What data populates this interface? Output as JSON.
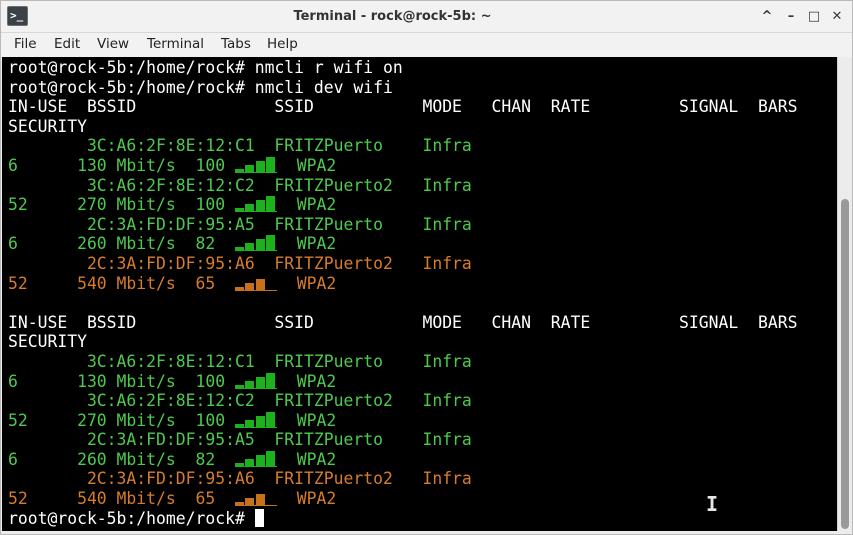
{
  "window": {
    "title": "Terminal - rock@rock-5b: ~",
    "icon": "terminal-app-icon",
    "icon_glyph": ">_",
    "controls": {
      "chevron": "^",
      "minimize": "–",
      "maximize": "□",
      "close": "✕"
    }
  },
  "menubar": [
    "File",
    "Edit",
    "View",
    "Terminal",
    "Tabs",
    "Help"
  ],
  "colors": {
    "background": "#000000",
    "text": "#ffffff",
    "green": "#4ec94e",
    "orange": "#d87c2c",
    "bar_green": "#1db11d",
    "bar_orange": "#c8711c"
  },
  "terminal": {
    "prompt": "root@rock-5b:/home/rock#",
    "commands": [
      "nmcli r wifi on",
      "nmcli dev wifi"
    ],
    "header_line1": "IN-USE  BSSID              SSID           MODE   CHAN  RATE         SIGNAL  BARS",
    "header_line2": "SECURITY",
    "networks": [
      {
        "bssid_line": "        3C:A6:2F:8E:12:C1  FRITZPuerto    Infra",
        "detail_line": "6      130 Mbit/s  100",
        "security": "WPA2",
        "bars": 4,
        "color": "green"
      },
      {
        "bssid_line": "        3C:A6:2F:8E:12:C2  FRITZPuerto2   Infra",
        "detail_line": "52     270 Mbit/s  100",
        "security": "WPA2",
        "bars": 4,
        "color": "green"
      },
      {
        "bssid_line": "        2C:3A:FD:DF:95:A5  FRITZPuerto    Infra",
        "detail_line": "6      260 Mbit/s  82 ",
        "security": "WPA2",
        "bars": 4,
        "color": "green"
      },
      {
        "bssid_line": "        2C:3A:FD:DF:95:A6  FRITZPuerto2   Infra",
        "detail_line": "52     540 Mbit/s  65 ",
        "security": "WPA2",
        "bars": 3,
        "color": "orange"
      }
    ],
    "final_prompt": "root@rock-5b:/home/rock#"
  }
}
